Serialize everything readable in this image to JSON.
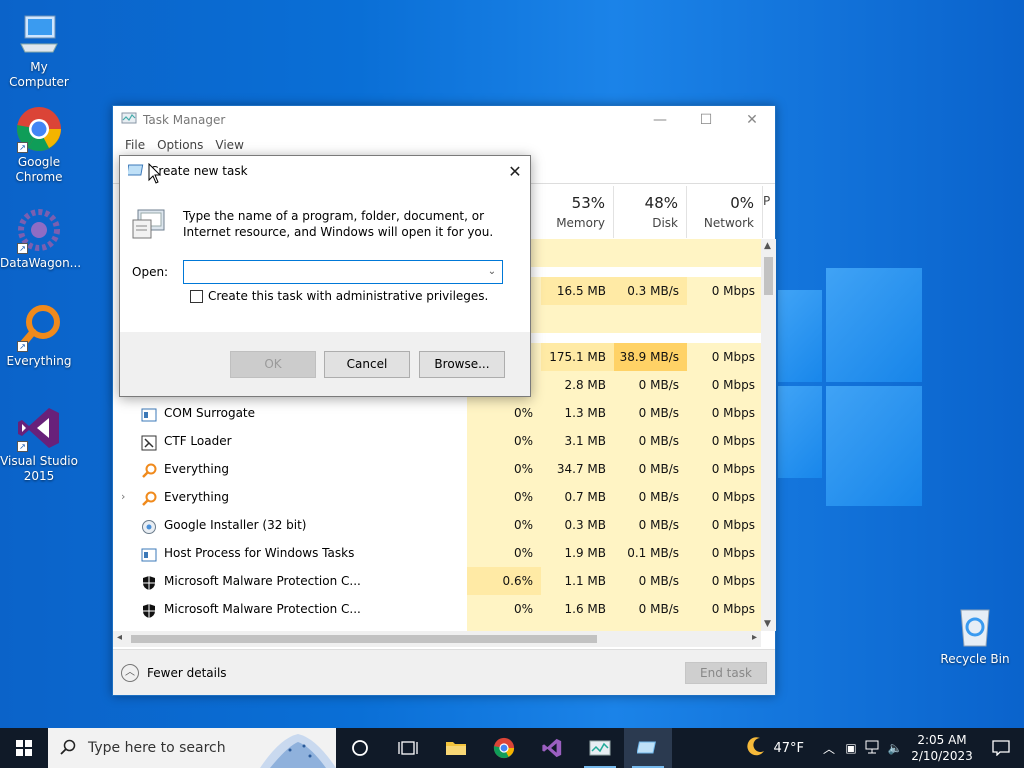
{
  "desktop": {
    "icons": [
      {
        "label": "My Computer"
      },
      {
        "label": "Google Chrome"
      },
      {
        "label": "DataWagon..."
      },
      {
        "label": "Everything"
      },
      {
        "label": "Visual Studio 2015"
      },
      {
        "label": "Recycle Bin"
      }
    ]
  },
  "task_manager": {
    "title": "Task Manager",
    "menu": [
      "File",
      "Options",
      "View"
    ],
    "columns": [
      {
        "pct": "53%",
        "name": "Memory"
      },
      {
        "pct": "48%",
        "name": "Disk"
      },
      {
        "pct": "0%",
        "name": "Network"
      },
      {
        "pct": "",
        "name": "P"
      }
    ],
    "partial_rows": [
      {
        "cpu": "",
        "mem": "16.5 MB",
        "disk": "0.3 MB/s",
        "net": "0 Mbps"
      },
      {
        "cpu": "",
        "mem": "175.1 MB",
        "disk": "38.9 MB/s",
        "net": "0 Mbps"
      },
      {
        "cpu": "",
        "mem": "2.8 MB",
        "disk": "0 MB/s",
        "net": "0 Mbps"
      }
    ],
    "rows": [
      {
        "name": "COM Surrogate",
        "cpu": "0%",
        "mem": "1.3 MB",
        "disk": "0 MB/s",
        "net": "0 Mbps"
      },
      {
        "name": "CTF Loader",
        "cpu": "0%",
        "mem": "3.1 MB",
        "disk": "0 MB/s",
        "net": "0 Mbps"
      },
      {
        "name": "Everything",
        "cpu": "0%",
        "mem": "34.7 MB",
        "disk": "0 MB/s",
        "net": "0 Mbps"
      },
      {
        "name": "Everything",
        "cpu": "0%",
        "mem": "0.7 MB",
        "disk": "0 MB/s",
        "net": "0 Mbps"
      },
      {
        "name": "Google Installer (32 bit)",
        "cpu": "0%",
        "mem": "0.3 MB",
        "disk": "0 MB/s",
        "net": "0 Mbps"
      },
      {
        "name": "Host Process for Windows Tasks",
        "cpu": "0%",
        "mem": "1.9 MB",
        "disk": "0.1 MB/s",
        "net": "0 Mbps"
      },
      {
        "name": "Microsoft Malware Protection C...",
        "cpu": "0.6%",
        "mem": "1.1 MB",
        "disk": "0 MB/s",
        "net": "0 Mbps"
      },
      {
        "name": "Microsoft Malware Protection C...",
        "cpu": "0%",
        "mem": "1.6 MB",
        "disk": "0 MB/s",
        "net": "0 Mbps"
      }
    ],
    "fewer_details": "Fewer details",
    "end_task": "End task"
  },
  "run_dialog": {
    "title": "Create new task",
    "description": "Type the name of a program, folder, document, or Internet resource, and Windows will open it for you.",
    "open_label": "Open:",
    "open_value": "",
    "admin_checkbox": "Create this task with administrative privileges.",
    "ok": "OK",
    "cancel": "Cancel",
    "browse": "Browse..."
  },
  "taskbar": {
    "search_placeholder": "Type here to search",
    "weather": "47°F",
    "time": "2:05 AM",
    "date": "2/10/2023"
  }
}
